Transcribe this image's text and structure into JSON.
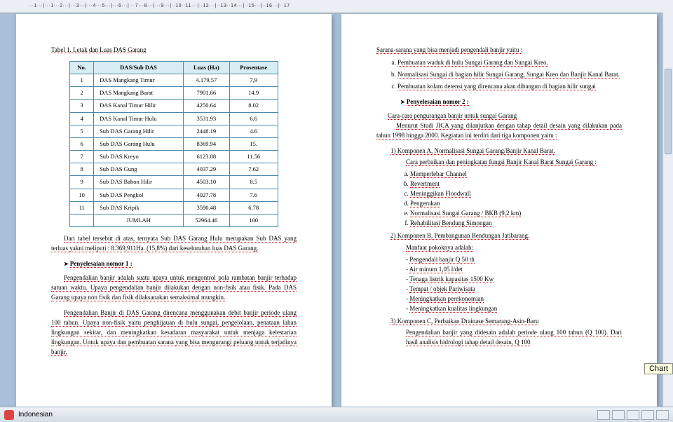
{
  "ruler": {
    "labels": "···1···|···1···2···|···3···|···4···5···|···6···|···7···8···|···9···|··10··11···|··12···|··13··14···|··15···|··16···|··17"
  },
  "statusbar": {
    "language": "Indonesian"
  },
  "tooltip": {
    "chart": "Chart"
  },
  "page1": {
    "caption": "Tabel 1. Letak dan Luas DAS Garang",
    "headers": {
      "c0": "No.",
      "c1": "DAS/Sub DAS",
      "c2": "Luas (Ha)",
      "c3": "Prosentase"
    },
    "rows": [
      {
        "n": "1",
        "d": "DAS Mangkang Timur",
        "l": "4.179,57",
        "p": "7,9"
      },
      {
        "n": "2",
        "d": "DAS Mangkang Barat",
        "l": "7901.66",
        "p": "14.9"
      },
      {
        "n": "3",
        "d": "DAS Kanal Timur Hilir",
        "l": "4250.64",
        "p": "8.02"
      },
      {
        "n": "4",
        "d": "DAS Kanal Timur Hulu",
        "l": "3531.93",
        "p": "6.6"
      },
      {
        "n": "5",
        "d": "Sub DAS Garang Hilir",
        "l": "2448.19",
        "p": "4.6"
      },
      {
        "n": "6",
        "d": "Sub DAS Garang Hulu",
        "l": "8369.94",
        "p": "15."
      },
      {
        "n": "7",
        "d": "Sub DAS Kreyo",
        "l": "6123.88",
        "p": "11.56"
      },
      {
        "n": "8",
        "d": "Sub DAS Gung",
        "l": "4037.29",
        "p": "7.62"
      },
      {
        "n": "9",
        "d": "Sub DAS Babon Hilir",
        "l": "4503.10",
        "p": "8.5"
      },
      {
        "n": "10",
        "d": "Sub DAS Pengkol",
        "l": "4027.78",
        "p": "7.6"
      },
      {
        "n": "11",
        "d": "Sub DAS Kripik",
        "l": "3590.48",
        "p": "6.78"
      }
    ],
    "total": {
      "label": "JUMLAH",
      "l": "52964.46",
      "p": "100"
    },
    "para1": "Dari tabel tersebut di atas, ternyata Sub DAS Garang Hulu merupakan Sub DAS yang terluas yakni meliputi : 8.369,911Ha. (15,8%) dari keseluruhan luas DAS Garang.",
    "h1": "Penyelesaian nomor 1 :",
    "para2": "Pengendalian banjir adalah suatu upaya untuk mengontrol pola rambatan banjir terhadap satuan waktu. Upaya pengendalian banjir dilakukan dengan non-fisik atau fisik. Pada DAS Garang upaya non fisik dan fisik dilaksanakan semaksimal mungkin.",
    "para3": "Pengendalian Banjir di DAS Garang direncana menggunakan debit banjir periode ulang 100 tahun. Upaya non-fisik yaitu penghijauan di hulu sungai, pengelolaan, penataan lahan lingkungan sekitar, dan meningkatkan kesadaran masyarakat untuk menjaga kelestarian lingkungan. Untuk upaya dan pembuatan sarana yang bisa mengurangi peluang untuk terjadinya banjir."
  },
  "page2": {
    "intro": "Sarana-sarana yang bisa menjadi pengendali banjir yaitu :",
    "listA": {
      "a": "Pembuatan waduk di hulu Sungai Garang dan Sungai Kreo.",
      "b": "Normalisasi Sungai di bagian hilir Sungai Garang, Sungai Kreo dan Banjir Kanal Barat.",
      "c": "Pembuatan kolam detensi yang direncana akan dibangun di bagian hilir sungai"
    },
    "h2": "Penyelesaian nomor 2 :",
    "para1": "Cara-cara pengurangan banjir untuk sungai Garang",
    "para2": "Menurut Studi JICA yang dilanjutkan dengan tahap detail desain yang dilakukan pada tahun 1998 hingga 2000. Kegiatan ini terdiri dari tiga komponen yaitu :",
    "k1": {
      "title": "1) Komponen A, Normalisasi Sungai Garang/Banjir Kanal Barat.",
      "sub": "Cara perbaikan dan peningkatan fungsi Banjir Kanal Barat Sungai Garang :",
      "items": {
        "a": "Memperlebar Channel",
        "b": "Revertment",
        "c": "Meninggikan Floodwall",
        "d": "Pengerukan",
        "e": "Normalisasi Sungai Garang / BKB (9,2 km)",
        "f": "Rehabilitasi Bendung Simongan"
      }
    },
    "k2": {
      "title": "2) Komponen B, Pembangunan Bendungan Jatibarang.",
      "sub": "Manfaat pokoknya adalah:",
      "items": {
        "a": "Pengendali banjir Q 50 th",
        "b": "Air minum 1,05 l/det",
        "c": "Tenaga listrik kapasitas 1500 Kw",
        "d": "Tempat / objek Pariwisata",
        "e": "Meningkatkan perekonomian",
        "f": "Meningkatkan kualitas lingkungan"
      }
    },
    "k3": {
      "title": "3) Komponen C, Perbaikan Drainase Semarang-Asin-Baru",
      "text": "Pengendalian banjir yang didesain adalah periode ulang 100 tahun (Q 100). Dari hasil analisis hidrologi tahap detail desain, Q 100"
    }
  }
}
